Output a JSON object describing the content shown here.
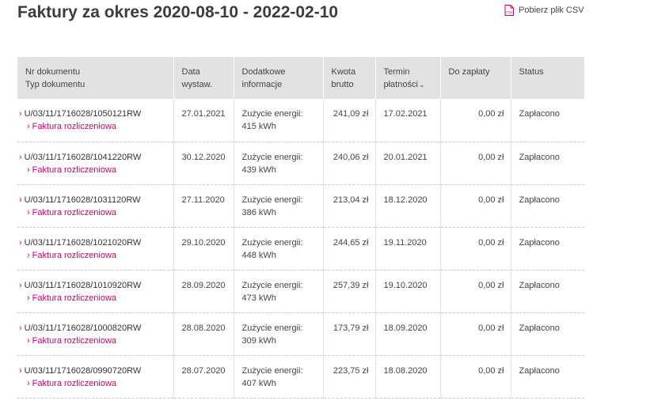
{
  "page": {
    "title": "Faktury za okres 2020-08-10 - 2022-02-10"
  },
  "csv_download": {
    "icon": "csv-file-icon",
    "icon_text": "CSV",
    "label": "Pobierz plik CSV"
  },
  "table": {
    "headers": {
      "doc_number": "Nr dokumentu",
      "doc_type": "Typ dokumentu",
      "issue_date_1": "Data",
      "issue_date_2": "wystaw.",
      "extra_1": "Dodatkowe",
      "extra_2": "informacje",
      "gross_1": "Kwota",
      "gross_2": "brutto",
      "due_1": "Termin",
      "due_2": "płatności",
      "to_pay": "Do zapłaty",
      "status": "Status"
    },
    "rows": [
      {
        "number": "U/03/11/1716028/1050121RW",
        "type": "Faktura rozliczeniowa",
        "date": "27.01.2021",
        "info_1": "Zużycie energii:",
        "info_2": "415 kWh",
        "gross": "241,09 zł",
        "due": "17.02.2021",
        "to_pay": "0,00 zł",
        "status": "Zapłacono"
      },
      {
        "number": "U/03/11/1716028/1041220RW",
        "type": "Faktura rozliczeniowa",
        "date": "30.12.2020",
        "info_1": "Zużycie energii:",
        "info_2": "439 kWh",
        "gross": "240,06 zł",
        "due": "20.01.2021",
        "to_pay": "0,00 zł",
        "status": "Zapłacono"
      },
      {
        "number": "U/03/11/1716028/1031120RW",
        "type": "Faktura rozliczeniowa",
        "date": "27.11.2020",
        "info_1": "Zużycie energii:",
        "info_2": "386 kWh",
        "gross": "213,04 zł",
        "due": "18.12.2020",
        "to_pay": "0,00 zł",
        "status": "Zapłacono"
      },
      {
        "number": "U/03/11/1716028/1021020RW",
        "type": "Faktura rozliczeniowa",
        "date": "29.10.2020",
        "info_1": "Zużycie energii:",
        "info_2": "448 kWh",
        "gross": "244,65 zł",
        "due": "19.11.2020",
        "to_pay": "0,00 zł",
        "status": "Zapłacono"
      },
      {
        "number": "U/03/11/1716028/1010920RW",
        "type": "Faktura rozliczeniowa",
        "date": "28.09.2020",
        "info_1": "Zużycie energii:",
        "info_2": "473 kWh",
        "gross": "257,39 zł",
        "due": "19.10.2020",
        "to_pay": "0,00 zł",
        "status": "Zapłacono"
      },
      {
        "number": "U/03/11/1716028/1000820RW",
        "type": "Faktura rozliczeniowa",
        "date": "28.08.2020",
        "info_1": "Zużycie energii:",
        "info_2": "309 kWh",
        "gross": "173,79 zł",
        "due": "18.09.2020",
        "to_pay": "0,00 zł",
        "status": "Zapłacono"
      },
      {
        "number": "U/03/11/1716028/0990720RW",
        "type": "Faktura rozliczeniowa",
        "date": "28.07.2020",
        "info_1": "Zużycie energii:",
        "info_2": "407 kWh",
        "gross": "223,75 zł",
        "due": "18.08.2020",
        "to_pay": "0,00 zł",
        "status": "Zapłacono"
      }
    ]
  },
  "colors": {
    "accent": "#c8006e",
    "header_bg": "#e2e2e2",
    "title": "#3c3c3c"
  }
}
